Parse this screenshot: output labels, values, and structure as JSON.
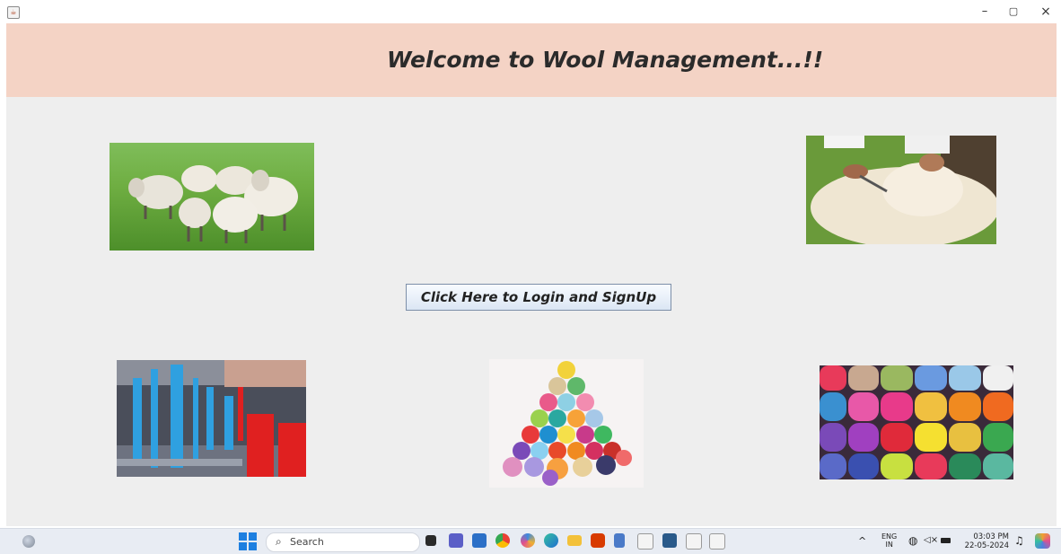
{
  "window": {
    "minimize_glyph": "–",
    "maximize_glyph": "▢",
    "close_glyph": "×",
    "app_icon": "java-icon"
  },
  "header": {
    "title": "Welcome to Wool Management...!!",
    "band_color": "#f4d3c5"
  },
  "images": [
    {
      "name": "sheep-flock-image",
      "subject": "flock of sheep in grass field"
    },
    {
      "name": "sheep-shearing-image",
      "subject": "sheep being sheared"
    },
    {
      "name": "textile-factory-image",
      "subject": "wool spinning machinery"
    },
    {
      "name": "yarn-pyramid-image",
      "subject": "pyramid of yarn balls"
    },
    {
      "name": "yarn-wall-image",
      "subject": "wall of colorful yarn balls"
    }
  ],
  "main": {
    "login_button_label": "Click Here to Login and SignUp"
  },
  "taskbar": {
    "search_label": "Search",
    "apps": [
      "file-explorer-icon",
      "teams-icon",
      "store-icon",
      "chrome-icon",
      "copilot-app-icon",
      "edge-icon",
      "folder-icon",
      "office-icon",
      "notepad-icon",
      "java-icon",
      "vscode-icon",
      "java-icon",
      "java-icon"
    ],
    "tray": {
      "chevron": "^",
      "lang_line1": "ENG",
      "lang_line2": "IN",
      "time": "03:03 PM",
      "date": "22-05-2024"
    }
  },
  "colors": {
    "app_background": "#eeeeee",
    "header_band": "#f4d3c5",
    "button_border": "#7d8fa8",
    "windows_blue": "#1d7fe0"
  }
}
